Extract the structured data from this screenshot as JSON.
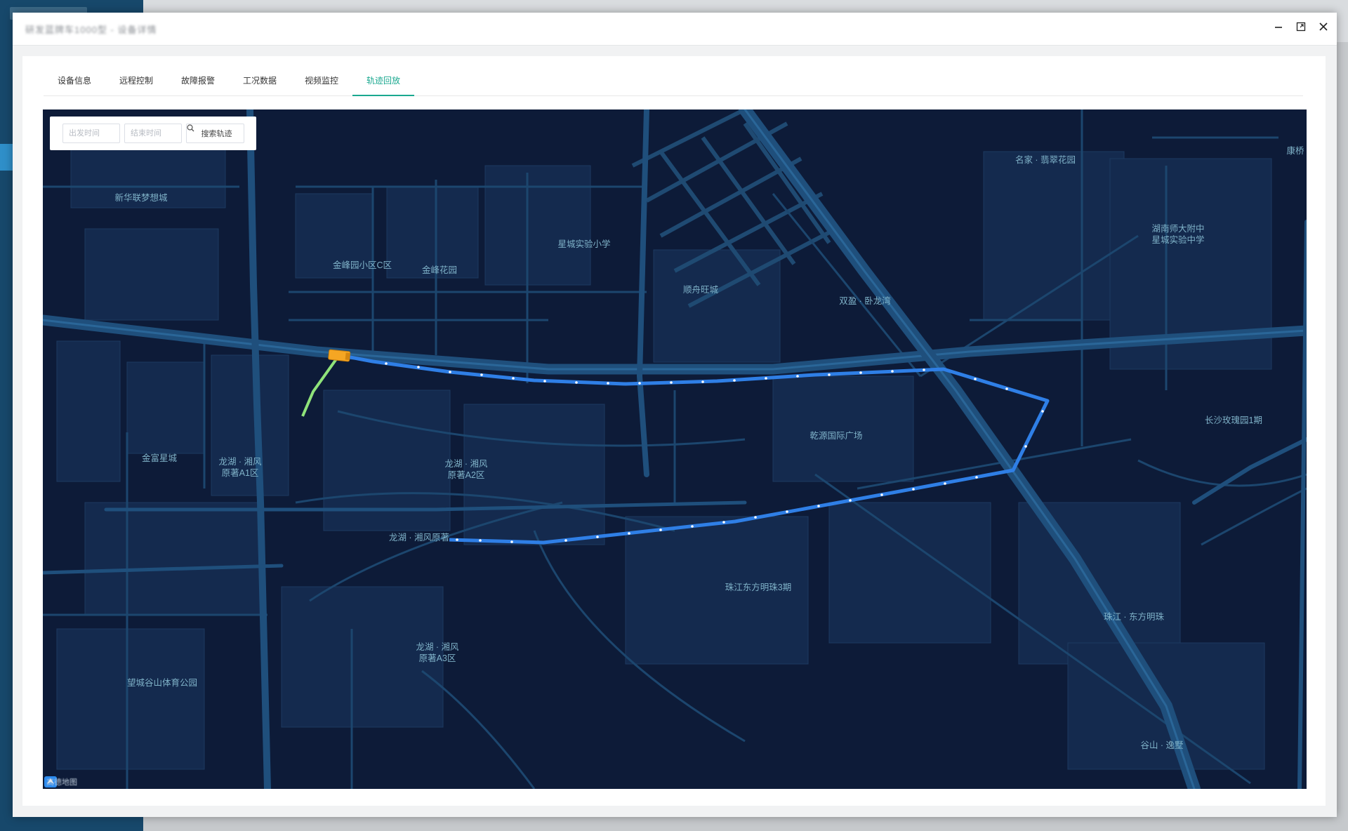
{
  "window": {
    "title": "研发蓝牌车1000型 - 设备详情"
  },
  "tabs": [
    {
      "label": "设备信息"
    },
    {
      "label": "远程控制"
    },
    {
      "label": "故障报警"
    },
    {
      "label": "工况数据"
    },
    {
      "label": "视频监控"
    },
    {
      "label": "轨迹回放",
      "active": true
    }
  ],
  "search": {
    "start_placeholder": "出发时间",
    "end_placeholder": "结束时间",
    "button_label": "搜索轨迹"
  },
  "map": {
    "provider_logo": "高德地图",
    "labels": {
      "xinhua": "新华联梦想城",
      "jinfeng_c": "金峰园小区C区",
      "jinfeng_garden": "金峰花园",
      "xingcheng_primary": "星城实验小学",
      "shunzhou": "顺舟旺城",
      "shuangying": "双盈 · 卧龙湾",
      "mingjia": "名家 · 翡翠花园",
      "hunan_normal": "湖南师大附中\n星城实验中学",
      "kangqiao": "康桥",
      "jinfu": "金富星城",
      "longhu_a1": "龙湖 · 湘风\n原著A1区",
      "longhu_a2": "龙湖 · 湘风\n原著A2区",
      "qianyuan": "乾源国际广场",
      "changsha_rose": "长沙玫瑰园1期",
      "longhu_yuanzhu": "龙湖 · 湘风原著",
      "zhujiang_3": "珠江东方明珠3期",
      "zhujiang": "珠江 · 东方明珠",
      "longhu_a3": "龙湖 · 湘风\n原著A3区",
      "wangcheng_park": "望城谷山体育公园",
      "gushan": "谷山 · 逸墅"
    }
  },
  "colors": {
    "accent": "#1aa88f",
    "map_bg": "#0d1b38",
    "track_played": "#8fe37a",
    "track_remaining": "#2f7fe6",
    "vehicle": "#f5a623"
  }
}
